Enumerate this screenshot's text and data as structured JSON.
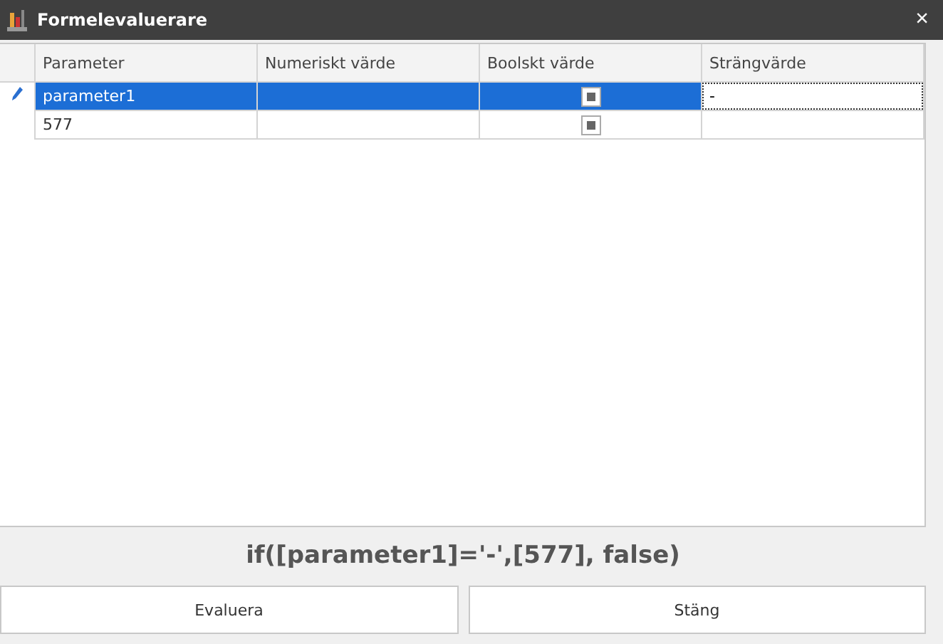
{
  "window": {
    "title": "Formelevaluerare",
    "close": "×"
  },
  "table": {
    "columns": [
      "Parameter",
      "Numeriskt värde",
      "Boolskt värde",
      "Strängvärde"
    ],
    "rows": [
      {
        "parameter": "parameter1",
        "numeric": "",
        "boolean_indeterminate": true,
        "string": "-",
        "selected": true,
        "editing": true
      },
      {
        "parameter": "577",
        "numeric": "",
        "boolean_indeterminate": true,
        "string": "",
        "selected": false,
        "editing": false
      }
    ]
  },
  "formula": "if([parameter1]='-',[577], false)",
  "buttons": [
    "Evaluera",
    "Stäng"
  ]
}
